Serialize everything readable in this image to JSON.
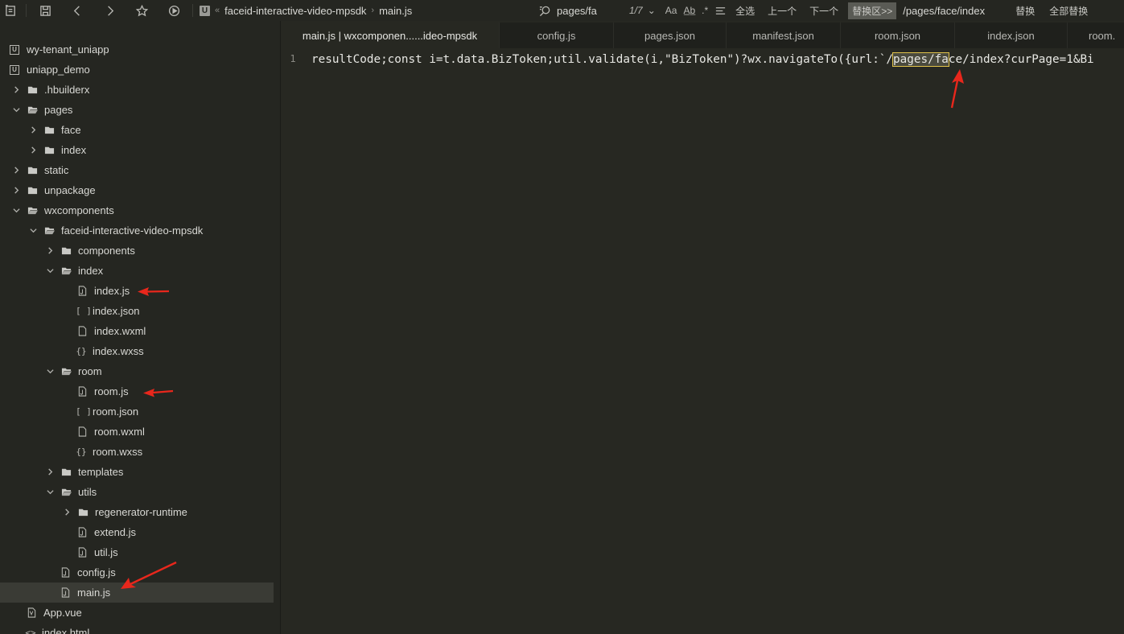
{
  "toolbar": {
    "breadcrumb_sep": "«",
    "breadcrumb_folder": "faceid-interactive-video-mpsdk",
    "breadcrumb_arrow": "›",
    "breadcrumb_file": "main.js",
    "search_value": "pages/fa",
    "match_count": "1/7",
    "case_label": "Aa",
    "word_label": "A̲b̲",
    "select_all": "全选",
    "prev": "上一个",
    "next": "下一个",
    "replace_area_label": "替换区>>",
    "replace_value": "/pages/face/index",
    "replace": "替换",
    "replace_all": "全部替换"
  },
  "sidebar": {
    "items": [
      {
        "label": "wy-tenant_uniapp",
        "type": "project"
      },
      {
        "label": "uniapp_demo",
        "type": "project"
      },
      {
        "label": ".hbuilderx",
        "type": "folder"
      },
      {
        "label": "pages",
        "type": "folder"
      },
      {
        "label": "face",
        "type": "folder"
      },
      {
        "label": "index",
        "type": "folder"
      },
      {
        "label": "static",
        "type": "folder"
      },
      {
        "label": "unpackage",
        "type": "folder"
      },
      {
        "label": "wxcomponents",
        "type": "folder"
      },
      {
        "label": "faceid-interactive-video-mpsdk",
        "type": "folder"
      },
      {
        "label": "components",
        "type": "folder"
      },
      {
        "label": "index",
        "type": "folder"
      },
      {
        "label": "index.js",
        "type": "js"
      },
      {
        "label": "index.json",
        "type": "json"
      },
      {
        "label": "index.wxml",
        "type": "file"
      },
      {
        "label": "index.wxss",
        "type": "css"
      },
      {
        "label": "room",
        "type": "folder"
      },
      {
        "label": "room.js",
        "type": "js"
      },
      {
        "label": "room.json",
        "type": "json"
      },
      {
        "label": "room.wxml",
        "type": "file"
      },
      {
        "label": "room.wxss",
        "type": "css"
      },
      {
        "label": "templates",
        "type": "folder"
      },
      {
        "label": "utils",
        "type": "folder"
      },
      {
        "label": "regenerator-runtime",
        "type": "folder"
      },
      {
        "label": "extend.js",
        "type": "js"
      },
      {
        "label": "util.js",
        "type": "js"
      },
      {
        "label": "config.js",
        "type": "js"
      },
      {
        "label": "main.js",
        "type": "js"
      },
      {
        "label": "App.vue",
        "type": "vue"
      },
      {
        "label": "index.html",
        "type": "html"
      }
    ]
  },
  "tabs": [
    {
      "label": "main.js | wxcomponen......ideo-mpsdk",
      "active": true
    },
    {
      "label": "config.js",
      "active": false
    },
    {
      "label": "pages.json",
      "active": false
    },
    {
      "label": "manifest.json",
      "active": false
    },
    {
      "label": "room.json",
      "active": false
    },
    {
      "label": "index.json",
      "active": false
    },
    {
      "label": "room.",
      "active": false
    }
  ],
  "editor": {
    "line_number": "1",
    "code_before": "resultCode;const i=t.data.BizToken;util.validate(i,\"BizToken\")?wx.navigateTo({url:`/",
    "code_match": "pages/fa",
    "code_after": "ce/index?curPage=1&Bi"
  },
  "colors": {
    "background": "#272822",
    "sidebar": "#252621",
    "highlight_border": "#e0c24a",
    "annotation_arrow": "#e8271c"
  }
}
